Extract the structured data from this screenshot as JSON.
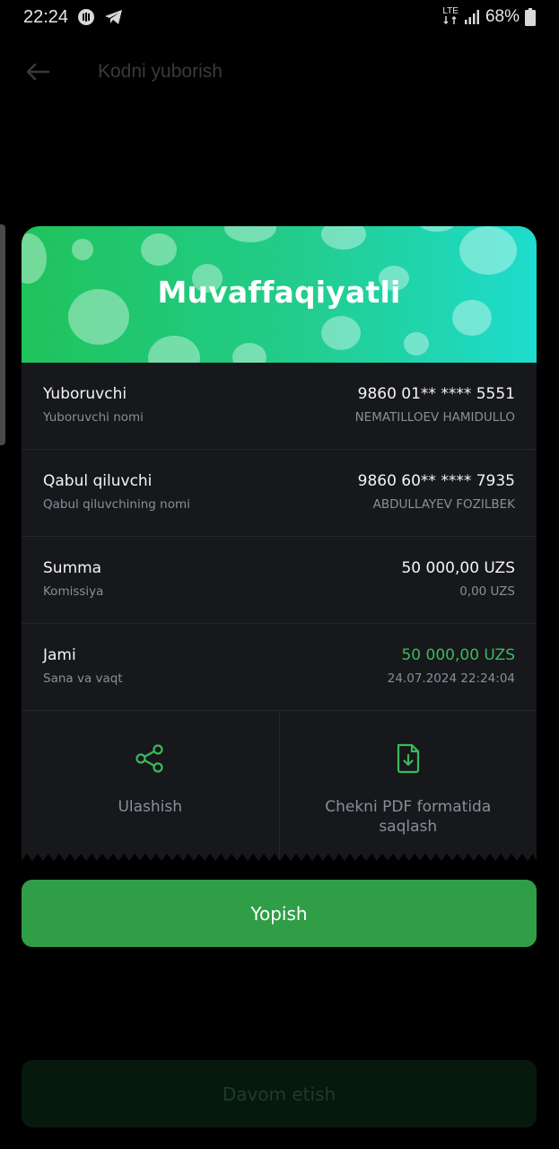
{
  "status_bar": {
    "time": "22:24",
    "network": "LTE",
    "battery": "68%"
  },
  "header": {
    "title": "Kodni yuborish"
  },
  "banner": {
    "title": "Muvaffaqiyatli"
  },
  "rows": [
    {
      "label": "Yuboruvchi",
      "sublabel": "Yuboruvchi nomi",
      "value": "9860 01** **** 5551",
      "subvalue": "NEMATILLOEV HAMIDULLO"
    },
    {
      "label": "Qabul qiluvchi",
      "sublabel": "Qabul qiluvchining nomi",
      "value": "9860 60** **** 7935",
      "subvalue": "ABDULLAYEV FOZILBEK"
    },
    {
      "label": "Summa",
      "sublabel": "Komissiya",
      "value": "50 000,00 UZS",
      "subvalue": "0,00 UZS"
    },
    {
      "label": "Jami",
      "sublabel": "Sana va vaqt",
      "value": "50 000,00 UZS",
      "subvalue": "24.07.2024 22:24:04"
    }
  ],
  "actions": {
    "share_label": "Ulashish",
    "save_pdf_label": "Chekni PDF formatida saqlash"
  },
  "buttons": {
    "close_label": "Yopish",
    "continue_label": "Davom etish"
  },
  "colors": {
    "accent_green": "#2f9e47",
    "total_green": "#3cb85c",
    "card_bg": "#16181c"
  }
}
